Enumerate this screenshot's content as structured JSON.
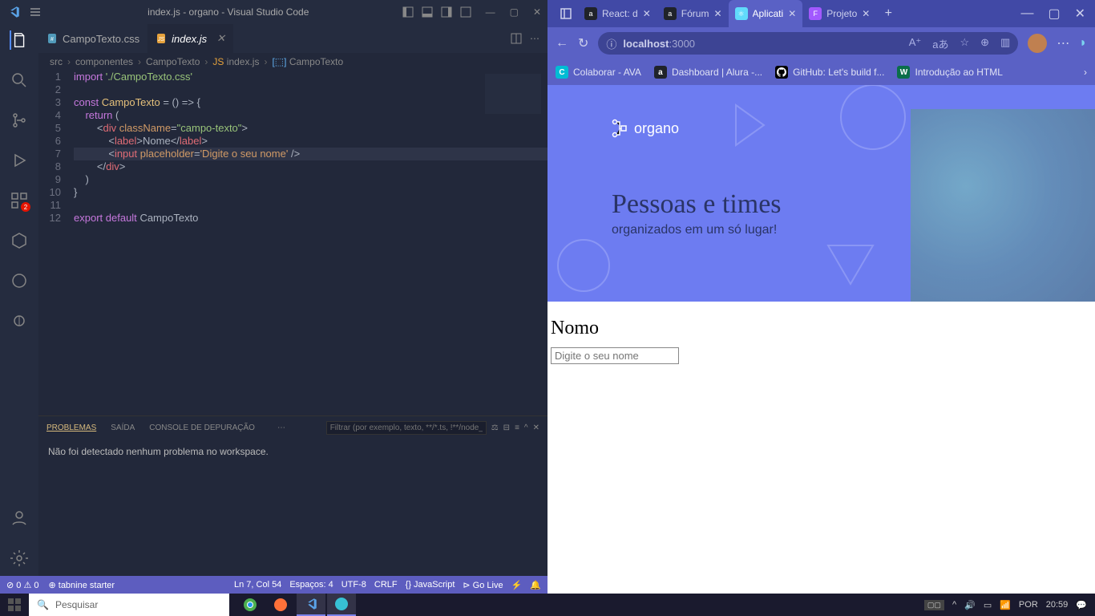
{
  "vscode": {
    "title": "index.js - organo - Visual Studio Code",
    "tabs": [
      {
        "label": "CampoTexto.css",
        "active": false,
        "icon_color": "#519aba"
      },
      {
        "label": "index.js",
        "active": true,
        "icon_color": "#e6a23c"
      }
    ],
    "breadcrumbs": [
      "src",
      "componentes",
      "CampoTexto",
      "index.js",
      "CampoTexto"
    ],
    "code_lines": [
      {
        "n": 1,
        "html": "<span class='kw'>import</span> <span class='str'>'./CampoTexto.css'</span>"
      },
      {
        "n": 2,
        "html": ""
      },
      {
        "n": 3,
        "html": "<span class='kw'>const</span> <span class='var'>CampoTexto</span> <span class='plain'>=</span> <span class='plain'>() =&gt; {</span>"
      },
      {
        "n": 4,
        "html": "    <span class='kw'>return</span> <span class='plain'>(</span>"
      },
      {
        "n": 5,
        "html": "        <span class='plain'>&lt;</span><span class='tag'>div</span> <span class='attr'>className</span><span class='plain'>=</span><span class='str'>\"campo-texto\"</span><span class='plain'>&gt;</span>"
      },
      {
        "n": 6,
        "html": "            <span class='plain'>&lt;</span><span class='tag'>label</span><span class='plain'>&gt;</span><span class='plain'>Nome</span><span class='plain'>&lt;/</span><span class='tag'>label</span><span class='plain'>&gt;</span>"
      },
      {
        "n": 7,
        "html": "            <span class='plain'>&lt;</span><span class='tag'>input</span> <span class='attr'>placeholder</span><span class='plain'>=</span><span class='str2'>'Digite o seu nome'</span> <span class='plain'>/&gt;</span>",
        "hl": true
      },
      {
        "n": 8,
        "html": "        <span class='plain'>&lt;/</span><span class='tag'>div</span><span class='plain'>&gt;</span>"
      },
      {
        "n": 9,
        "html": "    <span class='plain'>)</span>"
      },
      {
        "n": 10,
        "html": "<span class='plain'>}</span>"
      },
      {
        "n": 11,
        "html": ""
      },
      {
        "n": 12,
        "html": "<span class='kw'>export</span> <span class='kw'>default</span> <span class='plain'>CampoTexto</span>"
      }
    ],
    "panel": {
      "tabs": [
        "PROBLEMAS",
        "SAÍDA",
        "CONSOLE DE DEPURAÇÃO"
      ],
      "active_tab": "PROBLEMAS",
      "filter_placeholder": "Filtrar (por exemplo, texto, **/*.ts, !**/node_modules/**)",
      "message": "Não foi detectado nenhum problema no workspace."
    },
    "statusbar": {
      "left": [
        "⊘ 0 ⚠ 0",
        "⊕ tabnine starter"
      ],
      "right": [
        "Ln 7, Col 54",
        "Espaços: 4",
        "UTF-8",
        "CRLF",
        "{} JavaScript",
        "⊳ Go Live",
        "⚡",
        "🔔"
      ]
    }
  },
  "browser": {
    "tabs": [
      {
        "label": "React: d",
        "favicon_bg": "#20232a",
        "favicon_txt": "a",
        "active": false
      },
      {
        "label": "Fórum",
        "favicon_bg": "#20232a",
        "favicon_txt": "a",
        "active": false
      },
      {
        "label": "Aplicati",
        "favicon_bg": "#61dafb",
        "favicon_txt": "⚛",
        "active": true
      },
      {
        "label": "Projeto",
        "favicon_bg": "#a259ff",
        "favicon_txt": "F",
        "active": false
      }
    ],
    "url_prefix": "localhost",
    "url_suffix": ":3000",
    "bookmarks": [
      {
        "label": "Colaborar - AVA",
        "icon_bg": "#00bcd4",
        "icon_txt": "C"
      },
      {
        "label": "Dashboard | Alura -...",
        "icon_bg": "#20232a",
        "icon_txt": "a"
      },
      {
        "label": "GitHub: Let's build f...",
        "icon_bg": "#000",
        "icon_txt": ""
      },
      {
        "label": "Introdução ao HTML",
        "icon_bg": "#0a6e4a",
        "icon_txt": "W"
      }
    ],
    "page": {
      "logo": "organo",
      "hero_title": "Pessoas e times",
      "hero_sub": "organizados em um só lugar!",
      "field_label": "Nomo",
      "field_placeholder": "Digite o seu nome"
    }
  },
  "taskbar": {
    "search_placeholder": "Pesquisar",
    "time": "20:59"
  }
}
